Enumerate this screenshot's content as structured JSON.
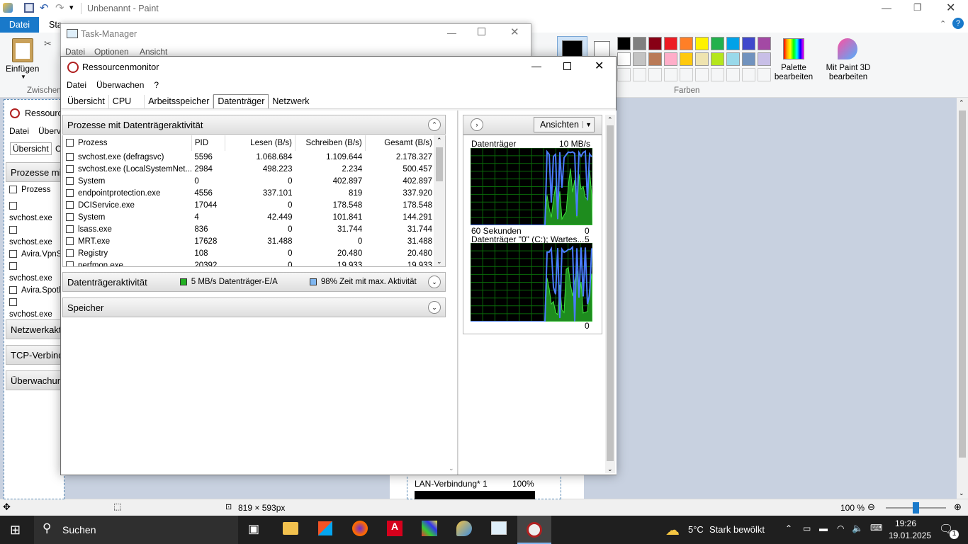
{
  "paint": {
    "title": "Unbenannt - Paint",
    "tab_datei": "Datei",
    "tab_start": "Sta",
    "einfuegen": "Einfügen",
    "zwischen": "Zwischen",
    "farben": "Farben",
    "palette": "Palette bearbeiten",
    "paint3d": "Mit Paint 3D bearbeiten",
    "dimensions": "819 × 593px",
    "zoom": "100 %",
    "colors_row1": [
      "#000000",
      "#7f7f7f",
      "#880015",
      "#ed1c24",
      "#ff7f27",
      "#fff200",
      "#22b14c",
      "#00a2e8",
      "#3f48cc",
      "#a349a4"
    ],
    "colors_row2": [
      "#ffffff",
      "#c3c3c3",
      "#b97a57",
      "#ffaec9",
      "#ffc90e",
      "#efe4b0",
      "#b5e61d",
      "#99d9ea",
      "#7092be",
      "#c8bfe7"
    ]
  },
  "bgmon": {
    "title": "Ressource",
    "menu": [
      "Datei",
      "Überv"
    ],
    "tabs": [
      "Übersicht",
      "C"
    ],
    "section": "Prozesse mi",
    "prozess": "Prozess",
    "rows": [
      "svchost.exe",
      "svchost.exe",
      "Avira.VpnS",
      "svchost.exe",
      "Avira.Spotl",
      "svchost.exe"
    ],
    "panels": [
      "Netzwerkakt",
      "TCP-Verbind",
      "Überwachun"
    ],
    "lan": "LAN-Verbindung* 1",
    "lan_pct": "100%"
  },
  "taskmgr": {
    "title": "Task-Manager",
    "menu": [
      "Datei",
      "Optionen",
      "Ansicht"
    ]
  },
  "resmon": {
    "title": "Ressourcenmonitor",
    "menu": [
      "Datei",
      "Überwachen",
      "?"
    ],
    "tabs": [
      "Übersicht",
      "CPU",
      "Arbeitsspeicher",
      "Datenträger",
      "Netzwerk"
    ],
    "section_processes": "Prozesse mit Datenträgeraktivität",
    "columns": [
      "Prozess",
      "PID",
      "Lesen (B/s)",
      "Schreiben (B/s)",
      "Gesamt (B/s)"
    ],
    "rows": [
      [
        "svchost.exe (defragsvc)",
        "5596",
        "1.068.684",
        "1.109.644",
        "2.178.327"
      ],
      [
        "svchost.exe (LocalSystemNet...",
        "2984",
        "498.223",
        "2.234",
        "500.457"
      ],
      [
        "System",
        "0",
        "0",
        "402.897",
        "402.897"
      ],
      [
        "endpointprotection.exe",
        "4556",
        "337.101",
        "819",
        "337.920"
      ],
      [
        "DCIService.exe",
        "17044",
        "0",
        "178.548",
        "178.548"
      ],
      [
        "System",
        "4",
        "42.449",
        "101.841",
        "144.291"
      ],
      [
        "lsass.exe",
        "836",
        "0",
        "31.744",
        "31.744"
      ],
      [
        "MRT.exe",
        "17628",
        "31.488",
        "0",
        "31.488"
      ],
      [
        "Registry",
        "108",
        "0",
        "20.480",
        "20.480"
      ],
      [
        "perfmon.exe",
        "20392",
        "0",
        "19.933",
        "19.933"
      ]
    ],
    "section_activity": "Datenträgeraktivität",
    "activity_io": "5 MB/s Datenträger-E/A",
    "activity_time": "98% Zeit mit max. Aktivität",
    "section_storage": "Speicher",
    "views_button": "Ansichten",
    "graph1_title": "Datenträger",
    "graph1_max": "10 MB/s",
    "graph1_footer": "60 Sekunden",
    "graph1_min": "0",
    "graph2_title": "Datenträger \"0\" (C:); Wartes...",
    "graph2_max": "5",
    "graph2_min": "0"
  },
  "taskbar": {
    "search": "Suchen",
    "weather_temp": "5°C",
    "weather_text": "Stark bewölkt",
    "time": "19:26",
    "date": "19.01.2025",
    "notifications": "1"
  }
}
